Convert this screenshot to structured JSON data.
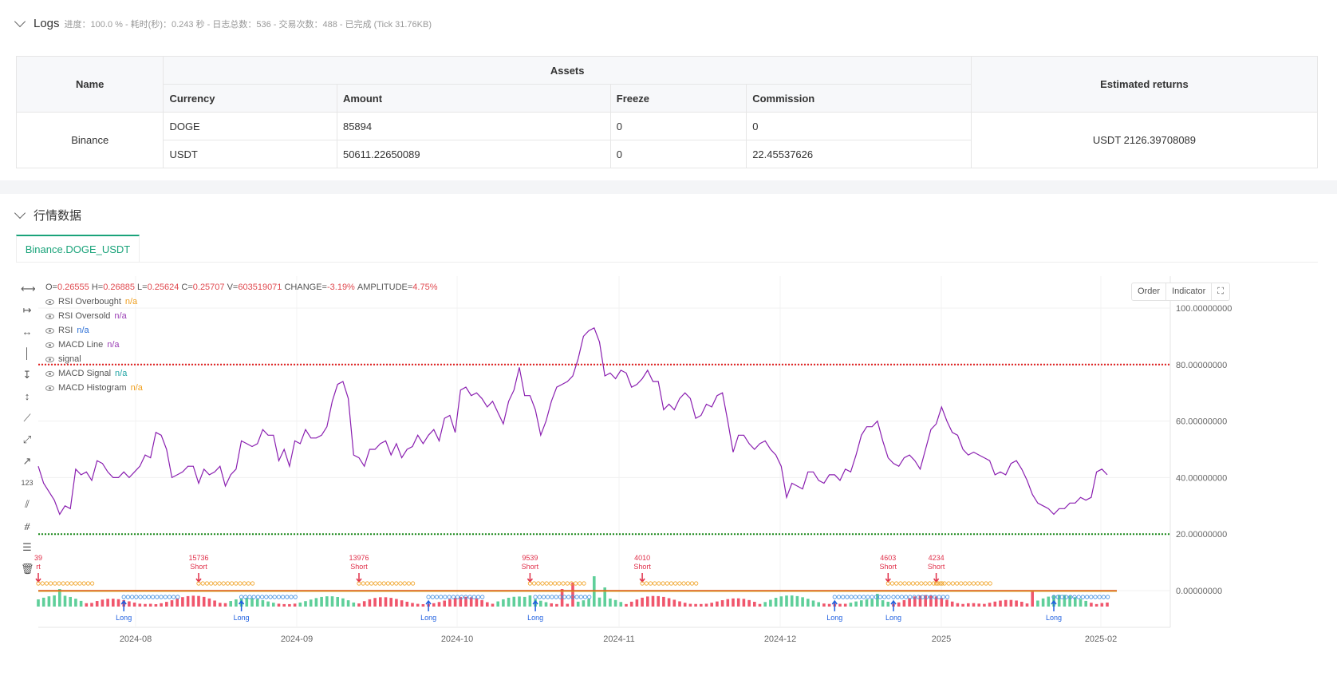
{
  "logs": {
    "title": "Logs",
    "meta": "进度：100.0 % - 耗时(秒)：0.243 秒 - 日志总数：536 - 交易次数：488 - 已完成 (Tick 31.76KB)"
  },
  "assets_table": {
    "headers": {
      "name": "Name",
      "assets": "Assets",
      "estimated": "Estimated returns",
      "currency": "Currency",
      "amount": "Amount",
      "freeze": "Freeze",
      "commission": "Commission"
    },
    "exchange": "Binance",
    "rows": [
      {
        "currency": "DOGE",
        "amount": "85894",
        "freeze": "0",
        "commission": "0"
      },
      {
        "currency": "USDT",
        "amount": "50611.22650089",
        "freeze": "0",
        "commission": "22.45537626"
      }
    ],
    "estimated_returns": "USDT 2126.39708089"
  },
  "market": {
    "title": "行情数据",
    "tab": "Binance.DOGE_USDT",
    "buttons": {
      "order": "Order",
      "indicator": "Indicator"
    }
  },
  "legend": {
    "ohlc": {
      "o_label": "O=",
      "o": "0.26555",
      "h_label": "H=",
      "h": "0.26885",
      "l_label": "L=",
      "l": "0.25624",
      "c_label": "C=",
      "c": "0.25707",
      "v_label": "V=",
      "v": "603519071",
      "change_label": "CHANGE=",
      "change": "-3.19%",
      "amp_label": "AMPLITUDE=",
      "amp": "4.75%"
    },
    "series": [
      {
        "name": "RSI Overbought",
        "value": "n/a"
      },
      {
        "name": "RSI Oversold",
        "value": "n/a"
      },
      {
        "name": "RSI",
        "value": "n/a"
      },
      {
        "name": "MACD Line",
        "value": "n/a"
      },
      {
        "name": "signal",
        "value": ""
      },
      {
        "name": "MACD Signal",
        "value": "n/a"
      },
      {
        "name": "MACD Histogram",
        "value": "n/a"
      }
    ]
  },
  "chart_data": {
    "type": "line",
    "y_ticks": [
      "100.00000000",
      "80.00000000",
      "60.00000000",
      "40.00000000",
      "20.00000000",
      "0.00000000"
    ],
    "x_ticks": [
      "2024-08",
      "2024-09",
      "2024-10",
      "2024-11",
      "2024-12",
      "2025",
      "2025-02"
    ],
    "ylim": [
      0,
      110
    ],
    "overbought": 80,
    "oversold": 20,
    "rsi": [
      44,
      38,
      35,
      32,
      27,
      30,
      29,
      43,
      41,
      42,
      39,
      46,
      45,
      42,
      40,
      40,
      42,
      40,
      42,
      44,
      48,
      47,
      56,
      55,
      50,
      40,
      41,
      42,
      44,
      44,
      38,
      43,
      41,
      42,
      44,
      37,
      41,
      43,
      53,
      52,
      51,
      52,
      57,
      55,
      55,
      46,
      50,
      44,
      53,
      52,
      57,
      54,
      54,
      55,
      58,
      67,
      73,
      74,
      68,
      48,
      47,
      44,
      50,
      50,
      52,
      53,
      48,
      52,
      47,
      50,
      51,
      55,
      52,
      55,
      57,
      53,
      61,
      62,
      56,
      71,
      72,
      69,
      70,
      68,
      65,
      67,
      63,
      59,
      67,
      71,
      79,
      69,
      69,
      64,
      55,
      60,
      67,
      72,
      73,
      74,
      76,
      82,
      90,
      92,
      93,
      88,
      76,
      77,
      75,
      78,
      77,
      72,
      73,
      75,
      78,
      74,
      74,
      64,
      66,
      64,
      68,
      70,
      68,
      61,
      62,
      66,
      65,
      69,
      70,
      60,
      49,
      55,
      55,
      52,
      50,
      52,
      53,
      50,
      48,
      44,
      33,
      38,
      37,
      36,
      42,
      42,
      39,
      38,
      41,
      41,
      39,
      43,
      42,
      48,
      55,
      58,
      58,
      60,
      53,
      47,
      45,
      44,
      47,
      48,
      46,
      43,
      50,
      57,
      59,
      65,
      60,
      56,
      55,
      50,
      48,
      49,
      48,
      47,
      46,
      41,
      42,
      41,
      45,
      46,
      43,
      39,
      34,
      31,
      30,
      29,
      27,
      29,
      29,
      31,
      31,
      33,
      32,
      33,
      42,
      43,
      41
    ],
    "trade_labels": [
      {
        "amount": "39",
        "side": "rt",
        "bar": 0
      },
      {
        "amount": "15736",
        "side": "Short",
        "bar": 30
      },
      {
        "amount": "13976",
        "side": "Short",
        "bar": 60
      },
      {
        "amount": "9539",
        "side": "Short",
        "bar": 92
      },
      {
        "amount": "4010",
        "side": "Short",
        "bar": 113
      },
      {
        "amount": "4603",
        "side": "Short",
        "bar": 159
      },
      {
        "amount": "4234",
        "side": "Short",
        "bar": 168
      }
    ],
    "long_labels": [
      {
        "side": "Long",
        "bar": 16
      },
      {
        "side": "Long",
        "bar": 38
      },
      {
        "side": "Long",
        "bar": 73
      },
      {
        "side": "Long",
        "bar": 93
      },
      {
        "side": "Long",
        "bar": 149
      },
      {
        "side": "Long",
        "bar": 160
      },
      {
        "side": "Long",
        "bar": 190
      }
    ]
  }
}
